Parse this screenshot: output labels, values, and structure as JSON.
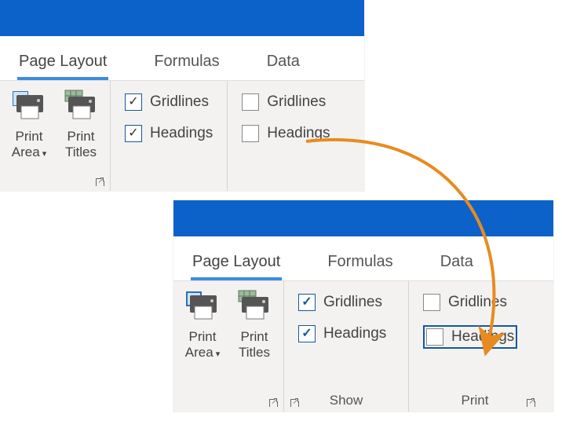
{
  "tabs": {
    "pageLayout": "Page Layout",
    "formulas": "Formulas",
    "data": "Data"
  },
  "buttons": {
    "printArea": "Print",
    "printArea2": "Area",
    "printTitles": "Print",
    "printTitles2": "Titles"
  },
  "labels": {
    "gridlines": "Gridlines",
    "headings": "Headings",
    "show": "Show",
    "print": "Print"
  }
}
